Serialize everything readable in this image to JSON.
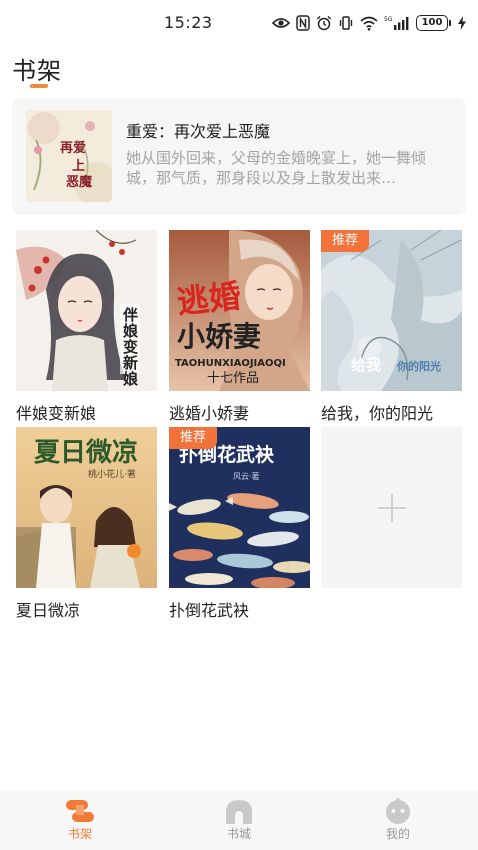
{
  "status_bar": {
    "time": "15:23",
    "network": "5G",
    "battery": "100"
  },
  "header": {
    "title": "书架"
  },
  "featured": {
    "title": "重爱：再次爱上恶魔",
    "description": "她从国外回来，父母的金婚晚宴上，她一舞倾城，那气质，那身段以及身上散发出来…",
    "cover_text": "再爱上恶魔"
  },
  "books": [
    {
      "title": "伴娘变新娘",
      "cover_text": "伴娘变新娘",
      "badge": ""
    },
    {
      "title": "逃婚小娇妻",
      "cover_text": "逃婚小娇妻",
      "cover_subtext": "TAOHUNXIAOJIAOQI",
      "cover_author": "十七作品",
      "badge": ""
    },
    {
      "title": "给我，你的阳光",
      "cover_text": "给我 你的阳光",
      "badge": "推荐"
    },
    {
      "title": "夏日微凉",
      "cover_text": "夏日微凉",
      "badge": ""
    },
    {
      "title": "扑倒花武袂",
      "cover_text": "扑倒花武袂",
      "badge": "推荐"
    }
  ],
  "add_tile": {
    "icon": "plus-icon"
  },
  "bottom_nav": [
    {
      "label": "书架",
      "icon": "bookshelf-icon",
      "active": true
    },
    {
      "label": "书城",
      "icon": "bookstore-icon",
      "active": false
    },
    {
      "label": "我的",
      "icon": "profile-icon",
      "active": false
    }
  ],
  "colors": {
    "accent": "#f07a37",
    "badge": "#f2723a",
    "card_bg": "#f6f6f6",
    "nav_bg": "#f7f7f7"
  }
}
